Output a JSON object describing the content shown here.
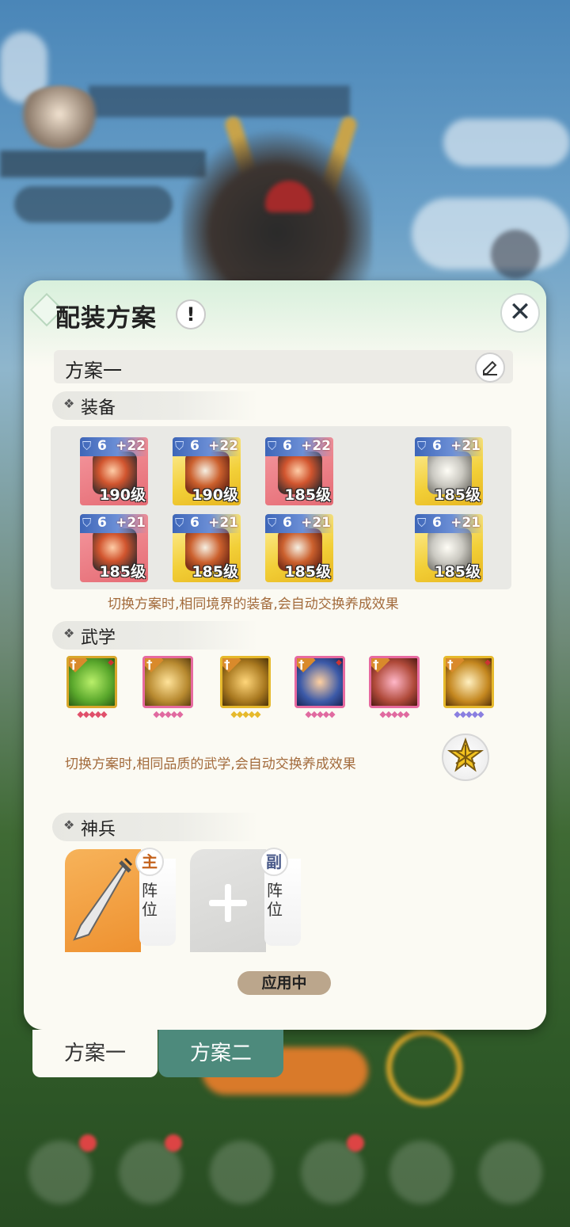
{
  "dialog": {
    "title": "配装方案",
    "info_icon": "exclamation-icon",
    "close_icon": "close-x-icon"
  },
  "plan": {
    "current_name": "方案一",
    "edit_icon": "edit-pencil-icon"
  },
  "equipment": {
    "section_label": "装备",
    "items": [
      {
        "tier": "6",
        "enhance": "+22",
        "level": "190级",
        "rarity": "red"
      },
      {
        "tier": "6",
        "enhance": "+22",
        "level": "190级",
        "rarity": "gold"
      },
      {
        "tier": "6",
        "enhance": "+22",
        "level": "185级",
        "rarity": "red"
      },
      {
        "tier": "6",
        "enhance": "+21",
        "level": "185级",
        "rarity": "gold"
      },
      {
        "tier": "6",
        "enhance": "+21",
        "level": "185级",
        "rarity": "red"
      },
      {
        "tier": "6",
        "enhance": "+21",
        "level": "185级",
        "rarity": "gold"
      },
      {
        "tier": "6",
        "enhance": "+21",
        "level": "185级",
        "rarity": "gold"
      },
      {
        "tier": "6",
        "enhance": "+21",
        "level": "185级",
        "rarity": "gold"
      }
    ],
    "note": "切换方案时,相同境界的装备,会自动交换养成效果"
  },
  "martial_arts": {
    "section_label": "武学",
    "skills": [
      {
        "frame": "#d9a72c",
        "art": "#5aa82c",
        "pip_color": "#e0506a"
      },
      {
        "frame": "#e76aa0",
        "art": "#b88a30",
        "pip_color": "#e06aa0"
      },
      {
        "frame": "#e6b92c",
        "art": "#a8781f",
        "pip_color": "#e6b92c"
      },
      {
        "frame": "#e76aa0",
        "art": "#3c5aa8",
        "pip_color": "#e06aa0"
      },
      {
        "frame": "#e76aa0",
        "art": "#b04a3a",
        "pip_color": "#e06aa0"
      },
      {
        "frame": "#e6b92c",
        "art": "#c4871f",
        "pip_color": "#8a7fe0"
      }
    ],
    "note": "切换方案时,相同品质的武学,会自动交换养成效果",
    "star_icon": "star-icon"
  },
  "divine_weapon": {
    "section_label": "神兵",
    "main": {
      "badge": "主",
      "label": "阵位"
    },
    "sub": {
      "badge": "副",
      "label": "阵位"
    },
    "add_icon": "plus-icon",
    "status": "应用中"
  },
  "tabs": [
    {
      "label": "方案一",
      "active": true
    },
    {
      "label": "方案二",
      "active": false
    }
  ],
  "colors": {
    "panel": "#fbfaf3",
    "accent_tab": "#4d8a7c",
    "note_text": "#a36b3c"
  }
}
